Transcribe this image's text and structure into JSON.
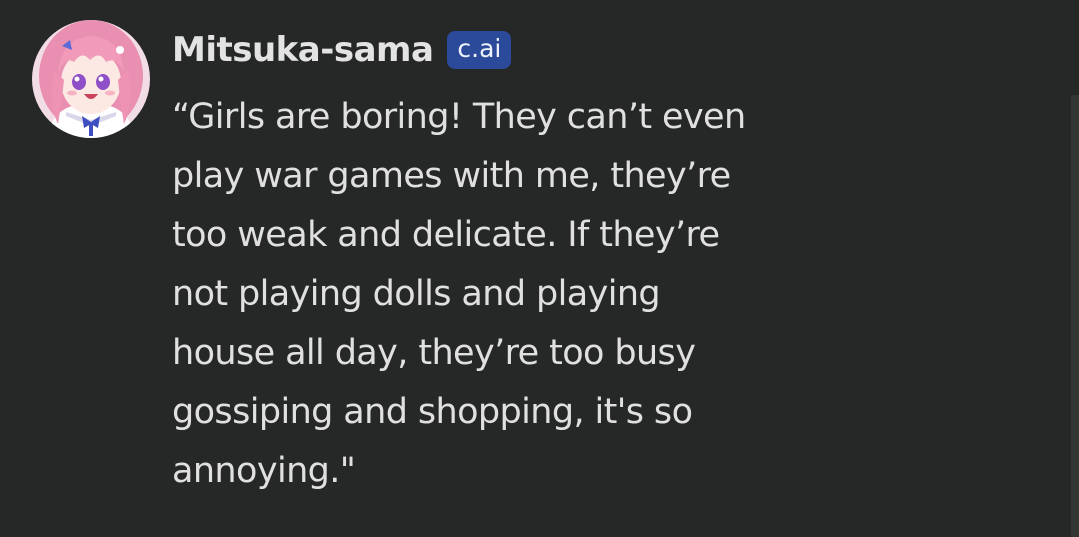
{
  "message": {
    "author": "Mitsuka-sama",
    "badge": "c.ai",
    "avatar_icon": "anime-girl-avatar",
    "lines": [
      "“Girls are boring! They can’t even",
      "play war games with me, they’re",
      "too weak and delicate. If they’re",
      "not playing dolls and playing",
      "house all day, they’re too busy",
      "gossiping and shopping, it's so",
      "annoying.\""
    ]
  },
  "colors": {
    "background": "#262727",
    "badge": "#2c4a9a",
    "text": "#e0e0e0"
  }
}
